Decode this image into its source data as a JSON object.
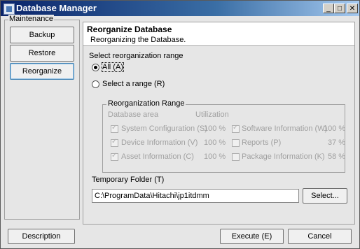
{
  "window": {
    "title": "Database Manager",
    "controls": [
      "minimize",
      "maximize",
      "close"
    ]
  },
  "maintenance": {
    "group_label": "Maintenance",
    "buttons": [
      "Backup",
      "Restore",
      "Reorganize"
    ]
  },
  "header": {
    "title": "Reorganize Database",
    "subtitle": "Reorganizing the Database."
  },
  "range": {
    "label": "Select reorganization range",
    "all_label": "All (A)",
    "select_label": "Select a range (R)",
    "selected": "all"
  },
  "reorg_range": {
    "label": "Reorganization Range",
    "col_area": "Database area",
    "col_util": "Utilization",
    "left_items": [
      {
        "label": "System Configuration (S)",
        "util": "100 %",
        "checked": true
      },
      {
        "label": "Device Information (V)",
        "util": "100 %",
        "checked": true
      },
      {
        "label": "Asset Information (C)",
        "util": "100 %",
        "checked": true
      }
    ],
    "right_items": [
      {
        "label": "Software Information (W)",
        "util": "100 %",
        "checked": true
      },
      {
        "label": "Reports (P)",
        "util": "37 %",
        "checked": false
      },
      {
        "label": "Package Information (K)",
        "util": "58 %",
        "checked": false
      }
    ]
  },
  "temp_folder": {
    "label": "Temporary Folder (T)",
    "value": "C:\\ProgramData\\Hitachi\\jp1itdmm",
    "select_label": "Select..."
  },
  "footer": {
    "description_label": "Description",
    "execute_label": "Execute (E)",
    "cancel_label": "Cancel"
  }
}
